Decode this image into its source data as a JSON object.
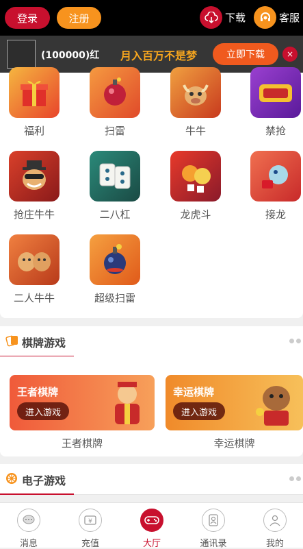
{
  "header": {
    "login_label": "登录",
    "register_label": "注册",
    "download_label": "下载",
    "service_label": "客服"
  },
  "banner": {
    "text": "(100000)红",
    "slogan": "月入百万不是梦",
    "download_button": "立即下载",
    "close_glyph": "×"
  },
  "games": [
    {
      "label": "福利",
      "color": "#e8452b"
    },
    {
      "label": "扫雷",
      "color": "#e9562a"
    },
    {
      "label": "牛牛",
      "color": "#d94a22"
    },
    {
      "label": "禁抢",
      "color": "#7a2fb5"
    },
    {
      "label": "抢庄牛牛",
      "color": "#b7302a"
    },
    {
      "label": "二八杠",
      "color": "#2b6b63"
    },
    {
      "label": "龙虎斗",
      "color": "#c22222"
    },
    {
      "label": "接龙",
      "color": "#d93a2a"
    },
    {
      "label": "二人牛牛",
      "color": "#c8452a"
    },
    {
      "label": "超级扫雷",
      "color": "#e8662a"
    }
  ],
  "sections": {
    "chess": {
      "title": "棋牌游戏"
    },
    "electronic": {
      "title": "电子游戏"
    }
  },
  "promo_cards": [
    {
      "title": "王者棋牌",
      "enter_label": "进入游戏",
      "caption": "王者棋牌",
      "color_from": "#f05a3a",
      "color_to": "#f7a05a"
    },
    {
      "title": "幸运棋牌",
      "enter_label": "进入游戏",
      "caption": "幸运棋牌",
      "color_from": "#f08a2a",
      "color_to": "#f7c05a"
    }
  ],
  "bottom_nav": [
    {
      "label": "消息",
      "icon": "chat-icon",
      "active": false
    },
    {
      "label": "充值",
      "icon": "recharge-icon",
      "active": false
    },
    {
      "label": "大厅",
      "icon": "gamepad-icon",
      "active": true
    },
    {
      "label": "通讯录",
      "icon": "contacts-icon",
      "active": false
    },
    {
      "label": "我的",
      "icon": "user-icon",
      "active": false
    }
  ],
  "colors": {
    "brand_red": "#c8102e",
    "brand_orange": "#f7931e"
  }
}
